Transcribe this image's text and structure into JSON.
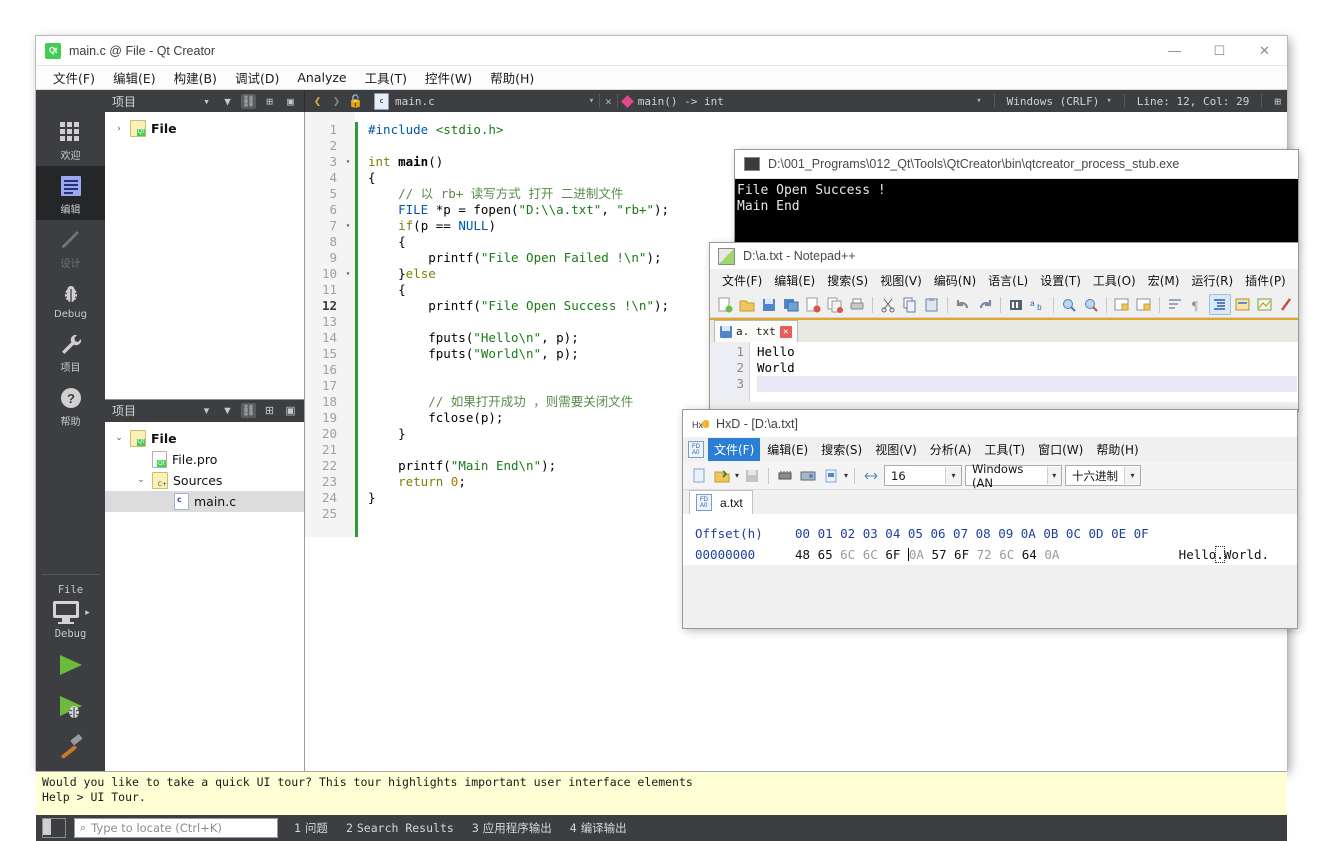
{
  "qtcreator": {
    "title": "main.c @ File - Qt Creator",
    "logo_text": "Qt",
    "window_buttons": {
      "minimize": "—",
      "maximize": "☐",
      "close": "✕"
    },
    "menubar": [
      "文件(F)",
      "编辑(E)",
      "构建(B)",
      "调试(D)",
      "Analyze",
      "工具(T)",
      "控件(W)",
      "帮助(H)"
    ],
    "project_panel": {
      "title": "项目",
      "top_tree": [
        {
          "label": "File",
          "arrow": "›",
          "icon": "qt-project-icon"
        }
      ],
      "bottom_title": "项目",
      "tree": [
        {
          "label": "File",
          "arrow": "⌄",
          "icon": "qt-project-icon",
          "indent": 0,
          "bold": true
        },
        {
          "label": "File.pro",
          "arrow": "",
          "icon": "qt-pro-file-icon",
          "indent": 1,
          "bold": false
        },
        {
          "label": "Sources",
          "arrow": "⌄",
          "icon": "cpp-folder-icon",
          "indent": 1,
          "bold": false
        },
        {
          "label": "main.c",
          "arrow": "",
          "icon": "c-file-icon",
          "indent": 2,
          "bold": false,
          "selected": true
        }
      ]
    },
    "editor_toolbar": {
      "document_name": "main.c",
      "symbol": "main() -> int",
      "line_ending": "Windows (CRLF)",
      "cursor_position": "Line: 12, Col: 29"
    },
    "modes": [
      {
        "label": "欢迎",
        "icon": "welcome-grid-icon",
        "state": "normal"
      },
      {
        "label": "编辑",
        "icon": "edit-document-icon",
        "state": "selected"
      },
      {
        "label": "设计",
        "icon": "design-pencil-icon",
        "state": "disabled"
      },
      {
        "label": "Debug",
        "icon": "debug-bug-icon",
        "state": "normal"
      },
      {
        "label": "项目",
        "icon": "projects-wrench-icon",
        "state": "normal"
      },
      {
        "label": "帮助",
        "icon": "help-question-icon",
        "state": "normal"
      }
    ],
    "kit_selector": {
      "project": "File",
      "build_config": "Debug"
    },
    "code": {
      "lines": [
        {
          "n": 1,
          "fold": "",
          "text": "#include <stdio.h>"
        },
        {
          "n": 2,
          "fold": "",
          "text": ""
        },
        {
          "n": 3,
          "fold": "▾",
          "text": "int main()"
        },
        {
          "n": 4,
          "fold": "",
          "text": "{"
        },
        {
          "n": 5,
          "fold": "",
          "text": "    // 以 rb+ 读写方式 打开 二进制文件"
        },
        {
          "n": 6,
          "fold": "",
          "text": "    FILE *p = fopen(\"D:\\\\a.txt\", \"rb+\");"
        },
        {
          "n": 7,
          "fold": "▾",
          "text": "    if(p == NULL)"
        },
        {
          "n": 8,
          "fold": "",
          "text": "    {"
        },
        {
          "n": 9,
          "fold": "",
          "text": "        printf(\"File Open Failed !\\n\");"
        },
        {
          "n": 10,
          "fold": "▾",
          "text": "    }else"
        },
        {
          "n": 11,
          "fold": "",
          "text": "    {"
        },
        {
          "n": 12,
          "fold": "",
          "text": "        printf(\"File Open Success !\\n\");"
        },
        {
          "n": 13,
          "fold": "",
          "text": ""
        },
        {
          "n": 14,
          "fold": "",
          "text": "        fputs(\"Hello\\n\", p);"
        },
        {
          "n": 15,
          "fold": "",
          "text": "        fputs(\"World\\n\", p);"
        },
        {
          "n": 16,
          "fold": "",
          "text": ""
        },
        {
          "n": 17,
          "fold": "",
          "text": ""
        },
        {
          "n": 18,
          "fold": "",
          "text": "        // 如果打开成功 ，则需要关闭文件"
        },
        {
          "n": 19,
          "fold": "",
          "text": "        fclose(p);"
        },
        {
          "n": 20,
          "fold": "",
          "text": "    }"
        },
        {
          "n": 21,
          "fold": "",
          "text": ""
        },
        {
          "n": 22,
          "fold": "",
          "text": "    printf(\"Main End\\n\");"
        },
        {
          "n": 23,
          "fold": "",
          "text": "    return 0;"
        },
        {
          "n": 24,
          "fold": "",
          "text": "}"
        },
        {
          "n": 25,
          "fold": "",
          "text": ""
        }
      ]
    },
    "tour_message_line1": "Would you like to take a quick UI tour? This tour highlights important user interface elements",
    "tour_message_line2": "Help > UI Tour.",
    "statusbar": {
      "locate_placeholder": "Type to locate (Ctrl+K)",
      "tabs": [
        {
          "n": "1",
          "label": "问题"
        },
        {
          "n": "2",
          "label": "Search Results"
        },
        {
          "n": "3",
          "label": "应用程序输出"
        },
        {
          "n": "4",
          "label": "编译输出"
        }
      ]
    }
  },
  "console": {
    "title": "D:\\001_Programs\\012_Qt\\Tools\\QtCreator\\bin\\qtcreator_process_stub.exe",
    "lines": [
      "File Open Success !",
      "Main End"
    ]
  },
  "notepadpp": {
    "title": "D:\\a.txt - Notepad++",
    "menubar": [
      "文件(F)",
      "编辑(E)",
      "搜索(S)",
      "视图(V)",
      "编码(N)",
      "语言(L)",
      "设置(T)",
      "工具(O)",
      "宏(M)",
      "运行(R)",
      "插件(P)"
    ],
    "tab": {
      "label": "a. txt",
      "close": "✕"
    },
    "editor_lines": [
      {
        "n": "1",
        "text": "Hello"
      },
      {
        "n": "2",
        "text": "World"
      },
      {
        "n": "3",
        "text": ""
      }
    ]
  },
  "hxd": {
    "title": "HxD - [D:\\a.txt]",
    "menubar": [
      "文件(F)",
      "编辑(E)",
      "搜索(S)",
      "视图(V)",
      "分析(A)",
      "工具(T)",
      "窗口(W)",
      "帮助(H)"
    ],
    "selected_menu": "文件(F)",
    "toolbar": {
      "bytes_per_row": "16",
      "encoding": "Windows (AN",
      "radix": "十六进制"
    },
    "tab": {
      "label": "a.txt"
    },
    "header": {
      "offset_label": "Offset(h)",
      "columns": [
        "00",
        "01",
        "02",
        "03",
        "04",
        "05",
        "06",
        "07",
        "08",
        "09",
        "0A",
        "0B",
        "0C",
        "0D",
        "0E",
        "0F"
      ]
    },
    "rows": [
      {
        "offset": "00000000",
        "bytes": [
          "48",
          "65",
          "6C",
          "6C",
          "6F",
          "0A",
          "57",
          "6F",
          "72",
          "6C",
          "64",
          "0A"
        ],
        "ascii_left": "Hello",
        "ascii_mid": ".",
        "ascii_right": "World."
      }
    ]
  },
  "colors": {
    "qt_green": "#41cd52",
    "qt_dark": "#3c3e41",
    "qt_darker": "#252628",
    "editor_bg": "#ffffff",
    "console_bg": "#000000",
    "tour_bg": "#ffffd6",
    "hxd_blue": "#1f3f9e",
    "npp_orange": "#e3a42a"
  }
}
